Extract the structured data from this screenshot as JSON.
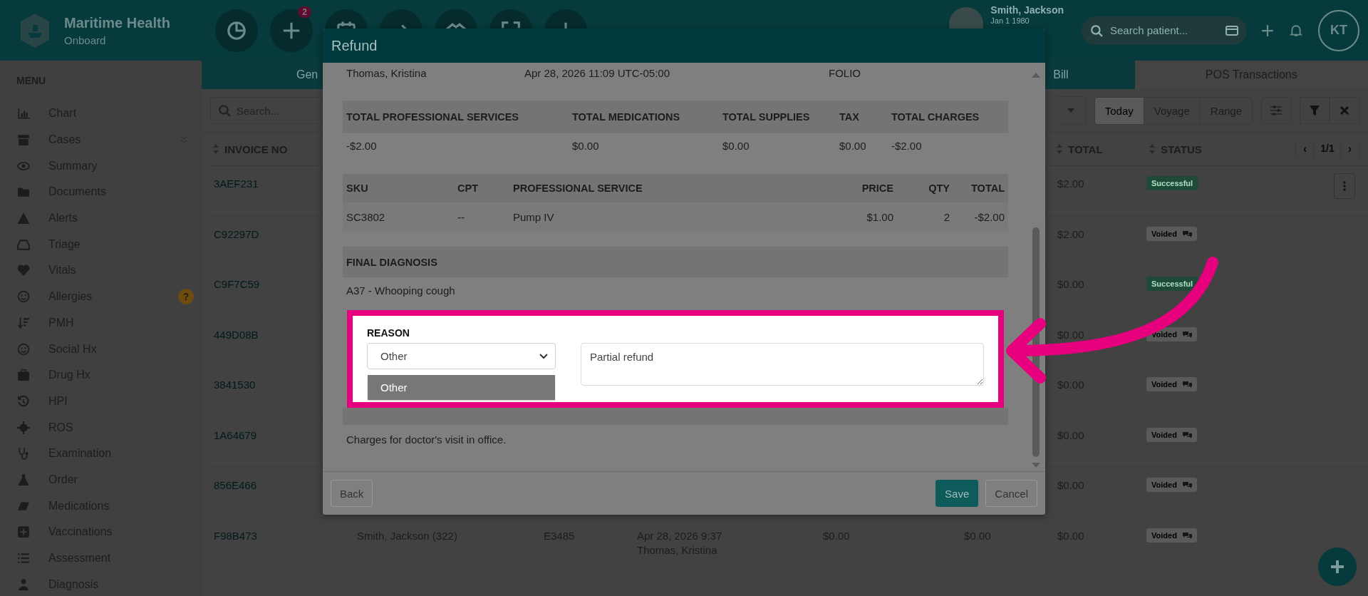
{
  "top_bar": {
    "brand": "Maritime Health",
    "subtitle": "Onboard",
    "quick_actions_badge": "2",
    "patient": {
      "name": "Smith, Jackson",
      "dob": "Jan 1 1980"
    },
    "search": {
      "placeholder": "Search patient..."
    },
    "user_initials": "KT"
  },
  "sidebar": {
    "title": "MENU",
    "items": [
      {
        "label": "Chart",
        "expandable": false
      },
      {
        "label": "Cases",
        "expandable": true
      },
      {
        "label": "Summary",
        "expandable": false
      },
      {
        "label": "Documents",
        "expandable": false
      },
      {
        "label": "Alerts",
        "expandable": false
      },
      {
        "label": "Triage",
        "expandable": false
      },
      {
        "label": "Vitals",
        "expandable": false
      },
      {
        "label": "Allergies",
        "expandable": false,
        "badge": "?"
      },
      {
        "label": "PMH",
        "expandable": false
      },
      {
        "label": "Social Hx",
        "expandable": false
      },
      {
        "label": "Drug Hx",
        "expandable": false
      },
      {
        "label": "HPI",
        "expandable": false
      },
      {
        "label": "ROS",
        "expandable": false
      },
      {
        "label": "Examination",
        "expandable": false
      },
      {
        "label": "Order",
        "expandable": false
      },
      {
        "label": "Medications",
        "expandable": false
      },
      {
        "label": "Vaccinations",
        "expandable": false
      },
      {
        "label": "Assessment",
        "expandable": false
      },
      {
        "label": "Diagnosis",
        "expandable": false
      }
    ]
  },
  "tabs": [
    {
      "label": "Gen",
      "selected": false
    },
    {
      "label": "Bill",
      "selected": false
    },
    {
      "label": "POS Transactions",
      "selected": true
    }
  ],
  "toolbar": {
    "search": {
      "placeholder": "Search..."
    },
    "periods": [
      {
        "label": "Today",
        "selected": true
      },
      {
        "label": "Voyage",
        "selected": false
      },
      {
        "label": "Range",
        "selected": false
      }
    ]
  },
  "table": {
    "columns": [
      {
        "label": "INVOICE NO"
      },
      {
        "label": "TOTAL"
      },
      {
        "label": "STATUS"
      }
    ],
    "pagination": {
      "prev": "‹",
      "page": "1/1",
      "next": "›"
    },
    "rows": [
      {
        "invoice_no": "3AEF231",
        "total": "$2.00",
        "status": "Successful",
        "kind": "successful",
        "menu": true
      },
      {
        "invoice_no": "C92297D",
        "total": "$2.00",
        "status": "Voided",
        "kind": "voided",
        "menu": false
      },
      {
        "invoice_no": "C9F7C59",
        "total": "$0.00",
        "status": "Successful",
        "kind": "successful",
        "menu": false
      },
      {
        "invoice_no": "449D08B",
        "total": "$0.00",
        "status": "Voided",
        "kind": "voided",
        "menu": false
      },
      {
        "invoice_no": "3841530",
        "total": "$0.00",
        "status": "Voided",
        "kind": "voided",
        "menu": false
      },
      {
        "invoice_no": "1A64679",
        "total": "$0.00",
        "status": "Voided",
        "kind": "voided",
        "menu": false
      },
      {
        "invoice_no": "856E466",
        "total": "$0.00",
        "status": "Voided",
        "kind": "voided",
        "menu": false
      },
      {
        "invoice_no": "F98B473",
        "patient": "Smith, Jackson (322)",
        "column_3": "E3485",
        "date": "Apr 28, 2026 9:37",
        "user": "Thomas, Kristina",
        "column_5": "$0.00",
        "column_6": "$0.00",
        "total": "$0.00",
        "status": "Voided",
        "kind": "voided",
        "menu": false
      }
    ]
  },
  "refund_dialog": {
    "title": "Refund",
    "header_row": [
      "Thomas, Kristina",
      "Apr 28, 2026 11:09 UTC-05:00",
      "FOLIO"
    ],
    "totals": {
      "columns": [
        "TOTAL PROFESSIONAL SERVICES",
        "TOTAL MEDICATIONS",
        "TOTAL SUPPLIES",
        "TAX",
        "TOTAL CHARGES"
      ],
      "values": [
        "-$2.00",
        "$0.00",
        "$0.00",
        "$0.00",
        "-$2.00"
      ]
    },
    "services": {
      "columns": [
        "SKU",
        "CPT",
        "PROFESSIONAL SERVICE",
        "PRICE",
        "QTY",
        "TOTAL"
      ],
      "rows": [
        [
          "SC3802",
          "--",
          "Pump IV",
          "$1.00",
          "2",
          "-$2.00"
        ]
      ]
    },
    "final_diagnosis": {
      "heading": "FINAL DIAGNOSIS",
      "text": "A37 - Whooping cough"
    },
    "reason": {
      "label": "REASON",
      "value": "Other",
      "options": [
        {
          "label": "Other",
          "selected": true
        }
      ],
      "note": "Partial refund"
    },
    "invoice_notes": {
      "text": "Charges for doctor's visit in office."
    },
    "buttons": [
      {
        "label": "Back",
        "kind": "secondary"
      },
      {
        "label": "Save",
        "kind": "primary"
      },
      {
        "label": "Cancel",
        "kind": "secondary"
      }
    ]
  }
}
